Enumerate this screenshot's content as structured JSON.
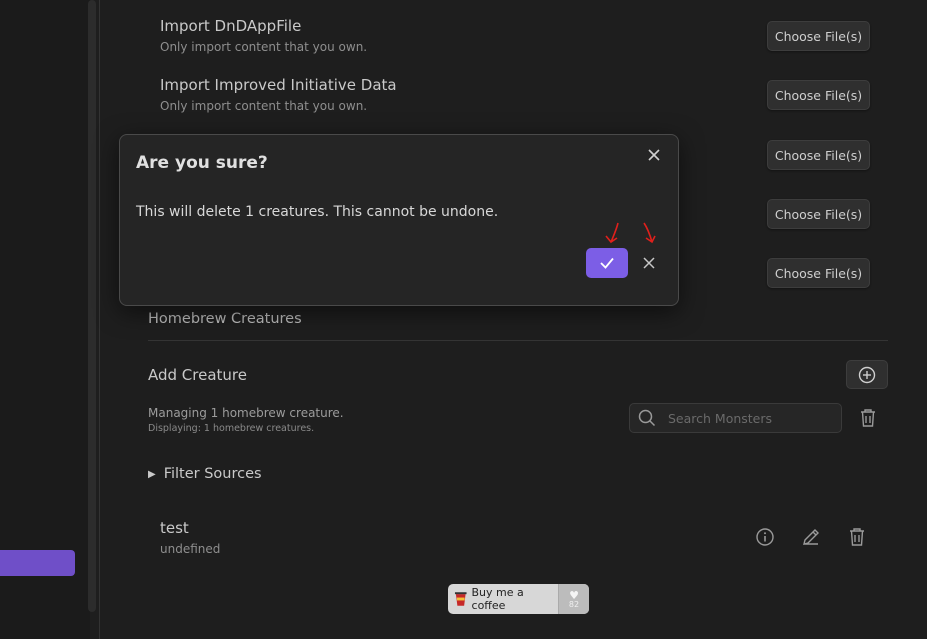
{
  "imports": [
    {
      "title": "Import DnDAppFile",
      "desc": "Only import content that you own.",
      "button": "Choose File(s)"
    },
    {
      "title": "Import Improved Initiative Data",
      "desc": "Only import content that you own.",
      "button": "Choose File(s)"
    },
    {
      "button": "Choose File(s)"
    },
    {
      "button": "Choose File(s)"
    },
    {
      "button": "Choose File(s)"
    }
  ],
  "homebrew": {
    "heading": "Homebrew Creatures",
    "add_label": "Add Creature",
    "managing": "Managing 1 homebrew creature.",
    "displaying": "Displaying: 1 homebrew creatures.",
    "search_placeholder": "Search Monsters",
    "filter_label": "Filter Sources"
  },
  "creatures": [
    {
      "name": "test",
      "subtitle": "undefined"
    }
  ],
  "coffee": {
    "label": "Buy me a coffee",
    "count": "82"
  },
  "modal": {
    "title": "Are you sure?",
    "message": "This will delete 1 creatures. This cannot be undone."
  },
  "colors": {
    "accent": "#7c5ee6",
    "sidebar_active": "#6f4fc8",
    "annotation": "#e0201c"
  },
  "icons": [
    "plus-circle-icon",
    "search-icon",
    "trash-icon",
    "info-icon",
    "pencil-icon",
    "close-icon",
    "check-icon",
    "coffee-cup-icon",
    "heart-icon"
  ]
}
